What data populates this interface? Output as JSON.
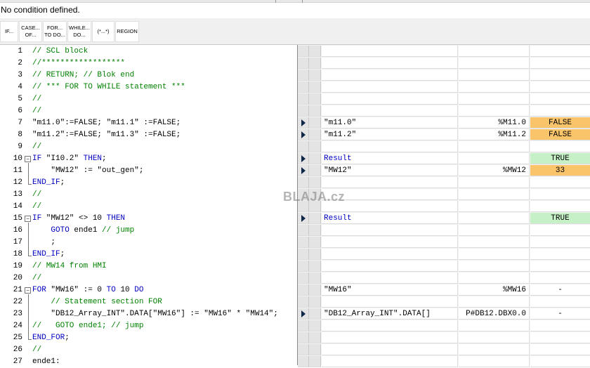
{
  "status_text": "No condition defined.",
  "toolbar": [
    {
      "label": "IF..."
    },
    {
      "label": "CASE...\nOF..."
    },
    {
      "label": "FOR...\nTO DO..."
    },
    {
      "label": "WHILE...\nDO..."
    },
    {
      "label": "(*...*)"
    },
    {
      "label": "REGION"
    }
  ],
  "code_lines": [
    {
      "num": "1",
      "text": "// SCL block",
      "type": "comment"
    },
    {
      "num": "2",
      "text": "//******************",
      "type": "comment"
    },
    {
      "num": "3",
      "text": "// RETURN; // Blok end",
      "type": "comment"
    },
    {
      "num": "4",
      "text": "// *** FOR TO WHILE statement ***",
      "type": "comment"
    },
    {
      "num": "5",
      "text": "//",
      "type": "comment"
    },
    {
      "num": "6",
      "text": "//",
      "type": "comment"
    },
    {
      "num": "7",
      "text": "\"m11.0\":=FALSE; \"m11.1\" :=FALSE;",
      "type": "code"
    },
    {
      "num": "8",
      "text": "\"m11.2\":=FALSE; \"m11.3\" :=FALSE;",
      "type": "code"
    },
    {
      "num": "9",
      "text": "//",
      "type": "comment"
    },
    {
      "num": "10",
      "text": "IF \"I10.2\" THEN;",
      "type": "code"
    },
    {
      "num": "11",
      "text": "    \"MW12\" := \"out_gen\";",
      "type": "code"
    },
    {
      "num": "12",
      "text": "END_IF;",
      "type": "code"
    },
    {
      "num": "13",
      "text": "//",
      "type": "comment"
    },
    {
      "num": "14",
      "text": "//",
      "type": "comment"
    },
    {
      "num": "15",
      "text": "IF \"MW12\" <> 10 THEN",
      "type": "code"
    },
    {
      "num": "16",
      "text": "    GOTO ende1 // jump",
      "type": "code"
    },
    {
      "num": "17",
      "text": "    ;",
      "type": "code"
    },
    {
      "num": "18",
      "text": "END_IF;",
      "type": "code"
    },
    {
      "num": "19",
      "text": "// MW14 from HMI",
      "type": "comment"
    },
    {
      "num": "20",
      "text": "//",
      "type": "comment"
    },
    {
      "num": "21",
      "text": "FOR \"MW16\" := 0 TO 10 DO",
      "type": "code"
    },
    {
      "num": "22",
      "text": "    // Statement section FOR",
      "type": "comment"
    },
    {
      "num": "23",
      "text": "    \"DB12_Array_INT\".DATA[\"MW16\"] := \"MW16\" * \"MW14\";",
      "type": "code"
    },
    {
      "num": "24",
      "text": "//   GOTO ende1; // jump",
      "type": "comment"
    },
    {
      "num": "25",
      "text": "END_FOR;",
      "type": "code"
    },
    {
      "num": "26",
      "text": "//",
      "type": "comment"
    },
    {
      "num": "27",
      "text": "ende1:",
      "type": "code"
    }
  ],
  "watch_rows": [
    {
      "arrow": false,
      "name": "",
      "address": "",
      "value": "",
      "state": ""
    },
    {
      "arrow": false,
      "name": "",
      "address": "",
      "value": "",
      "state": ""
    },
    {
      "arrow": false,
      "name": "",
      "address": "",
      "value": "",
      "state": ""
    },
    {
      "arrow": false,
      "name": "",
      "address": "",
      "value": "",
      "state": ""
    },
    {
      "arrow": false,
      "name": "",
      "address": "",
      "value": "",
      "state": ""
    },
    {
      "arrow": false,
      "name": "",
      "address": "",
      "value": "",
      "state": ""
    },
    {
      "arrow": true,
      "name": "\"m11.0\"",
      "address": "%M11.0",
      "value": "FALSE",
      "state": "false"
    },
    {
      "arrow": true,
      "name": "\"m11.2\"",
      "address": "%M11.2",
      "value": "FALSE",
      "state": "false"
    },
    {
      "arrow": false,
      "name": "",
      "address": "",
      "value": "",
      "state": ""
    },
    {
      "arrow": true,
      "name": "Result",
      "address": "",
      "value": "TRUE",
      "state": "true",
      "result": true
    },
    {
      "arrow": true,
      "name": "\"MW12\"",
      "address": "%MW12",
      "value": "33",
      "state": "num"
    },
    {
      "arrow": false,
      "name": "",
      "address": "",
      "value": "",
      "state": ""
    },
    {
      "arrow": false,
      "name": "",
      "address": "",
      "value": "",
      "state": ""
    },
    {
      "arrow": false,
      "name": "",
      "address": "",
      "value": "",
      "state": ""
    },
    {
      "arrow": true,
      "name": "Result",
      "address": "",
      "value": "TRUE",
      "state": "true",
      "result": true
    },
    {
      "arrow": false,
      "name": "",
      "address": "",
      "value": "",
      "state": ""
    },
    {
      "arrow": false,
      "name": "",
      "address": "",
      "value": "",
      "state": ""
    },
    {
      "arrow": false,
      "name": "",
      "address": "",
      "value": "",
      "state": ""
    },
    {
      "arrow": false,
      "name": "",
      "address": "",
      "value": "",
      "state": ""
    },
    {
      "arrow": false,
      "name": "",
      "address": "",
      "value": "",
      "state": ""
    },
    {
      "arrow": false,
      "name": "\"MW16\"",
      "address": "%MW16",
      "value": "-",
      "state": ""
    },
    {
      "arrow": false,
      "name": "",
      "address": "",
      "value": "",
      "state": ""
    },
    {
      "arrow": true,
      "name": "\"DB12_Array_INT\".DATA[]",
      "address": "P#DB12.DBX0.0",
      "value": "-",
      "state": ""
    },
    {
      "arrow": false,
      "name": "",
      "address": "",
      "value": "",
      "state": ""
    },
    {
      "arrow": false,
      "name": "",
      "address": "",
      "value": "",
      "state": ""
    },
    {
      "arrow": false,
      "name": "",
      "address": "",
      "value": "",
      "state": ""
    },
    {
      "arrow": false,
      "name": "",
      "address": "",
      "value": "",
      "state": ""
    }
  ],
  "watermark": "BLAJA.cz",
  "colors": {
    "comment": "#008000",
    "keyword": "#0000c0",
    "false_bg": "#f9c46a",
    "true_bg": "#c6f0c6"
  }
}
